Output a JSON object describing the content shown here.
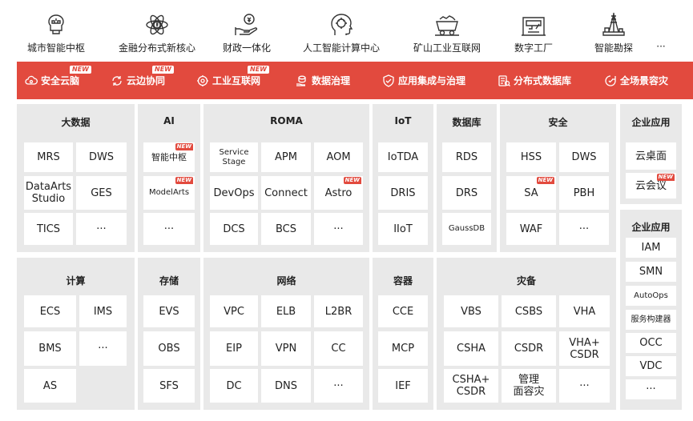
{
  "scenarios": [
    {
      "label": "城市智能中枢",
      "icon": "city-brain-icon"
    },
    {
      "label": "金融分布式新核心",
      "icon": "finance-atom-icon"
    },
    {
      "label": "财政一体化",
      "icon": "finance-hand-coin-icon"
    },
    {
      "label": "人工智能计算中心",
      "icon": "ai-head-icon"
    },
    {
      "label": "矿山工业互联网",
      "icon": "mine-cart-icon"
    },
    {
      "label": "数字工厂",
      "icon": "factory-icon"
    },
    {
      "label": "智能勘探",
      "icon": "drill-rig-icon"
    },
    {
      "label": "···",
      "icon": ""
    }
  ],
  "banner": {
    "badge": "NEW",
    "items": [
      {
        "label": "安全云脑",
        "icon": "cloud-eye-icon",
        "new": true
      },
      {
        "label": "云边协同",
        "icon": "cloud-sync-icon",
        "new": true
      },
      {
        "label": "工业互联网",
        "icon": "gear-network-icon",
        "new": true
      },
      {
        "label": "数据治理",
        "icon": "database-hand-icon",
        "new": false
      },
      {
        "label": "应用集成与治理",
        "icon": "shield-check-icon",
        "new": false
      },
      {
        "label": "分布式数据库",
        "icon": "db-scan-icon",
        "new": false
      },
      {
        "label": "全场景容灾",
        "icon": "recovery-icon",
        "new": false
      }
    ]
  },
  "new_tag": "NEW",
  "panels": {
    "bigdata": {
      "title": "大数据",
      "cells": [
        "MRS",
        "DWS",
        "DataArts Studio",
        "GES",
        "TICS",
        "···"
      ]
    },
    "ai": {
      "title": "AI",
      "cells": [
        "智能中枢",
        "ModelArts",
        "···"
      ]
    },
    "roma": {
      "title": "ROMA",
      "cells": [
        "Service Stage",
        "APM",
        "AOM",
        "DevOps",
        "Connect",
        "Astro",
        "DCS",
        "BCS",
        "···"
      ]
    },
    "iot": {
      "title": "IoT",
      "cells": [
        "IoTDA",
        "DRIS",
        "IIoT"
      ]
    },
    "database": {
      "title": "数据库",
      "cells": [
        "RDS",
        "DRS",
        "GaussDB"
      ]
    },
    "security": {
      "title": "安全",
      "cells": [
        "HSS",
        "DWS",
        "SA",
        "PBH",
        "WAF",
        "···"
      ]
    },
    "enterprise_app_1": {
      "title": "企业应用",
      "cells": [
        "云桌面",
        "云会议"
      ]
    },
    "enterprise_app_2": {
      "title": "企业应用",
      "cells": [
        "IAM",
        "SMN",
        "AutoOps",
        "服务构建器",
        "OCC",
        "VDC",
        "···"
      ]
    },
    "compute": {
      "title": "计算",
      "cells": [
        "ECS",
        "IMS",
        "BMS",
        "···",
        "AS"
      ]
    },
    "storage": {
      "title": "存储",
      "cells": [
        "EVS",
        "OBS",
        "SFS"
      ]
    },
    "network": {
      "title": "网络",
      "cells": [
        "VPC",
        "ELB",
        "L2BR",
        "EIP",
        "VPN",
        "CC",
        "DC",
        "DNS",
        "···"
      ]
    },
    "container": {
      "title": "容器",
      "cells": [
        "CCE",
        "MCP",
        "IEF"
      ]
    },
    "disaster": {
      "title": "灾备",
      "cells": [
        "VBS",
        "CSBS",
        "VHA",
        "CSHA",
        "CSDR",
        "VHA+ CSDR",
        "CSHA+ CSDR",
        "管理 面容灾",
        "···"
      ]
    }
  },
  "colors": {
    "accent": "#e24a3e",
    "panel": "#e9e9e9",
    "cell": "#ffffff"
  }
}
